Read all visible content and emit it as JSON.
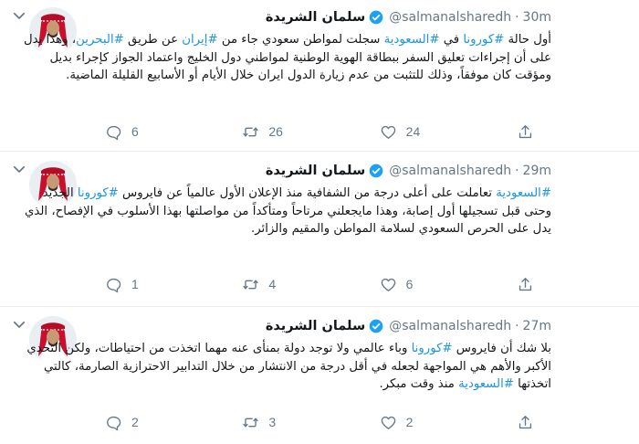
{
  "tweets": [
    {
      "name": "سلمان الشريدة",
      "handle": "@salmanalsharedh",
      "separator": "·",
      "time": "30m",
      "text": [
        {
          "t": "أول حالة "
        },
        {
          "t": "#كورونا",
          "tag": true
        },
        {
          "t": " في "
        },
        {
          "t": "#السعودية",
          "tag": true
        },
        {
          "t": " سجلت لمواطن سعودي جاء من "
        },
        {
          "t": "#إيران",
          "tag": true
        },
        {
          "t": " عن طريق "
        },
        {
          "t": "#البحرين",
          "tag": true
        },
        {
          "t": "، وهذا يدل على أن إجراءات تعليق السفر ببطاقة الهوية الوطنية لمواطني دول الخليج واعتماد الجواز كإجراء بديل ومؤقت كان موفقاً، وذلك للتثبت من عدم زيارة الدول ايران خلال الأيام أو الأسابيع القليلة الماضية."
        }
      ],
      "replies": "6",
      "retweets": "26",
      "likes": "24"
    },
    {
      "name": "سلمان الشريدة",
      "handle": "@salmanalsharedh",
      "separator": "·",
      "time": "29m",
      "text": [
        {
          "t": "#السعودية",
          "tag": true
        },
        {
          "t": " تعاملت على أعلى درجة من الشفافية منذ الإعلان الأول عالمياً عن فايروس "
        },
        {
          "t": "#كورونا",
          "tag": true
        },
        {
          "t": " الجديد وحتى قبل تسجيلها أول إصابة، وهذا مايجعلني مرتاحاً ومتأكداً من مواصلتها بهذا الأسلوب في الإفصاح، الذي يدل على الحرص السعودي لسلامة المواطن والمقيم والزائر."
        }
      ],
      "replies": "1",
      "retweets": "4",
      "likes": "6"
    },
    {
      "name": "سلمان الشريدة",
      "handle": "@salmanalsharedh",
      "separator": "·",
      "time": "27m",
      "text": [
        {
          "t": "بلا شك أن فايروس "
        },
        {
          "t": "#كورونا",
          "tag": true
        },
        {
          "t": " وباء عالمي ولا توجد دولة بمنأى عنه مهما اتخذت من احتياطات، ولكن التحدي الأكبر والأهم هي المواجهة لجعله في أقل درجة من الانتشار من خلال التدابير الاحترازية الصارمة، كالتي اتخذتها "
        },
        {
          "t": "#السعودية",
          "tag": true
        },
        {
          "t": " منذ وقت مبكر."
        }
      ],
      "replies": "2",
      "retweets": "3",
      "likes": "2"
    }
  ],
  "icons": {
    "reply": "reply-icon",
    "retweet": "retweet-icon",
    "like": "heart-icon",
    "share": "share-icon",
    "verified": "verified-badge-icon",
    "menu": "chevron-down-icon"
  },
  "colors": {
    "hashtag": "#1b95e0",
    "verified": "#1da1f2",
    "muted": "#657786",
    "text": "#14171a",
    "divider": "#e6ecf0"
  }
}
